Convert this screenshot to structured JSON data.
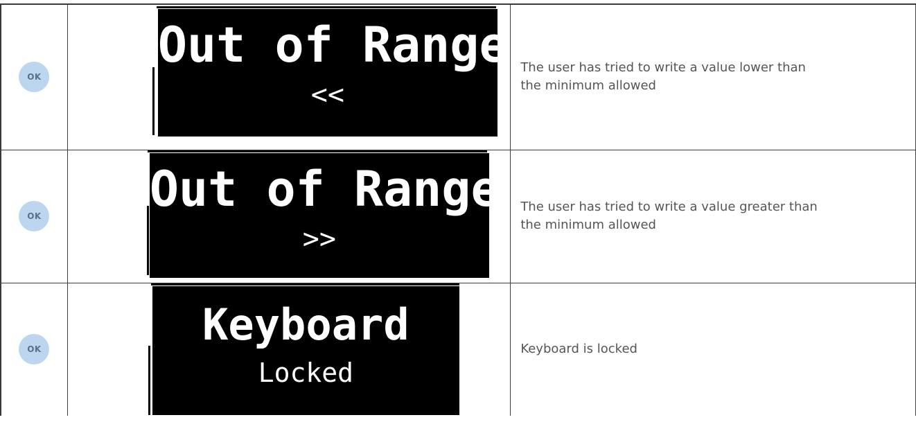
{
  "rows": [
    {
      "button": "OK",
      "display": {
        "line1": "Out of Range",
        "line2": "<<"
      },
      "description": "The user has tried to write a value lower than the minimum allowed"
    },
    {
      "button": "OK",
      "display": {
        "line1": "Out of Range",
        "line2": ">>"
      },
      "description": "The user has tried to write a value greater than the minimum allowed"
    },
    {
      "button": "OK",
      "display": {
        "line1": "Keyboard",
        "line2": "Locked"
      },
      "description": "Keyboard is locked"
    }
  ],
  "colors": {
    "ok_button_bg": "#bcd6f0",
    "ok_button_text": "#5d6f82",
    "lcd_bg": "#000000",
    "lcd_text": "#ffffff",
    "description_text": "#555555"
  }
}
